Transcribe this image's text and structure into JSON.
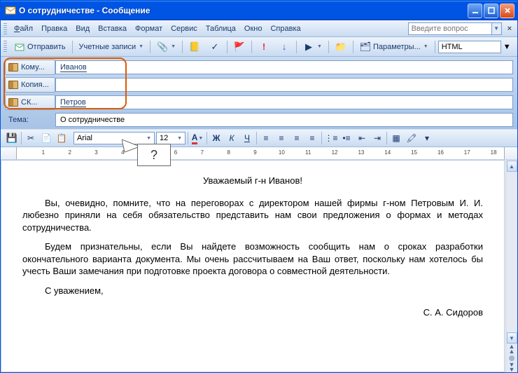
{
  "window": {
    "title": "О сотрудничестве - Сообщение"
  },
  "menu": {
    "file": "Файл",
    "edit": "Правка",
    "view": "Вид",
    "insert": "Вставка",
    "format": "Формат",
    "service": "Сервис",
    "table": "Таблица",
    "window": "Окно",
    "help": "Справка",
    "help_placeholder": "Введите вопрос"
  },
  "toolbar": {
    "send": "Отправить",
    "accounts": "Учетные записи",
    "options": "Параметры...",
    "format_select": "HTML"
  },
  "address": {
    "to_label": "Кому...",
    "cc_label": "Копия...",
    "bcc_label": "СК...",
    "subject_label": "Тема:",
    "to_value": "Иванов",
    "cc_value": "",
    "bcc_value": "Петров",
    "subject_value": "О сотрудничестве"
  },
  "callout": {
    "text": "?"
  },
  "format_bar": {
    "font": "Arial",
    "size": "12"
  },
  "body": {
    "greeting": "Уважаемый г-н Иванов!",
    "p1": "Вы, очевидно, помните, что на переговорах с директором нашей фирмы г-ном Петровым И. И. любезно приняли на себя обязательство представить нам свои предложения о формах и методах сотрудничества.",
    "p2": "Будем признательны, если Вы найдете возможность сообщить нам о сроках разработки окончательного варианта документа. Мы очень рассчитываем на Ваш ответ, поскольку нам хотелось бы учесть Ваши замечания при подготовке проекта договора о совместной деятельности.",
    "closing": "С уважением,",
    "signature": "С. А. Сидоров"
  }
}
